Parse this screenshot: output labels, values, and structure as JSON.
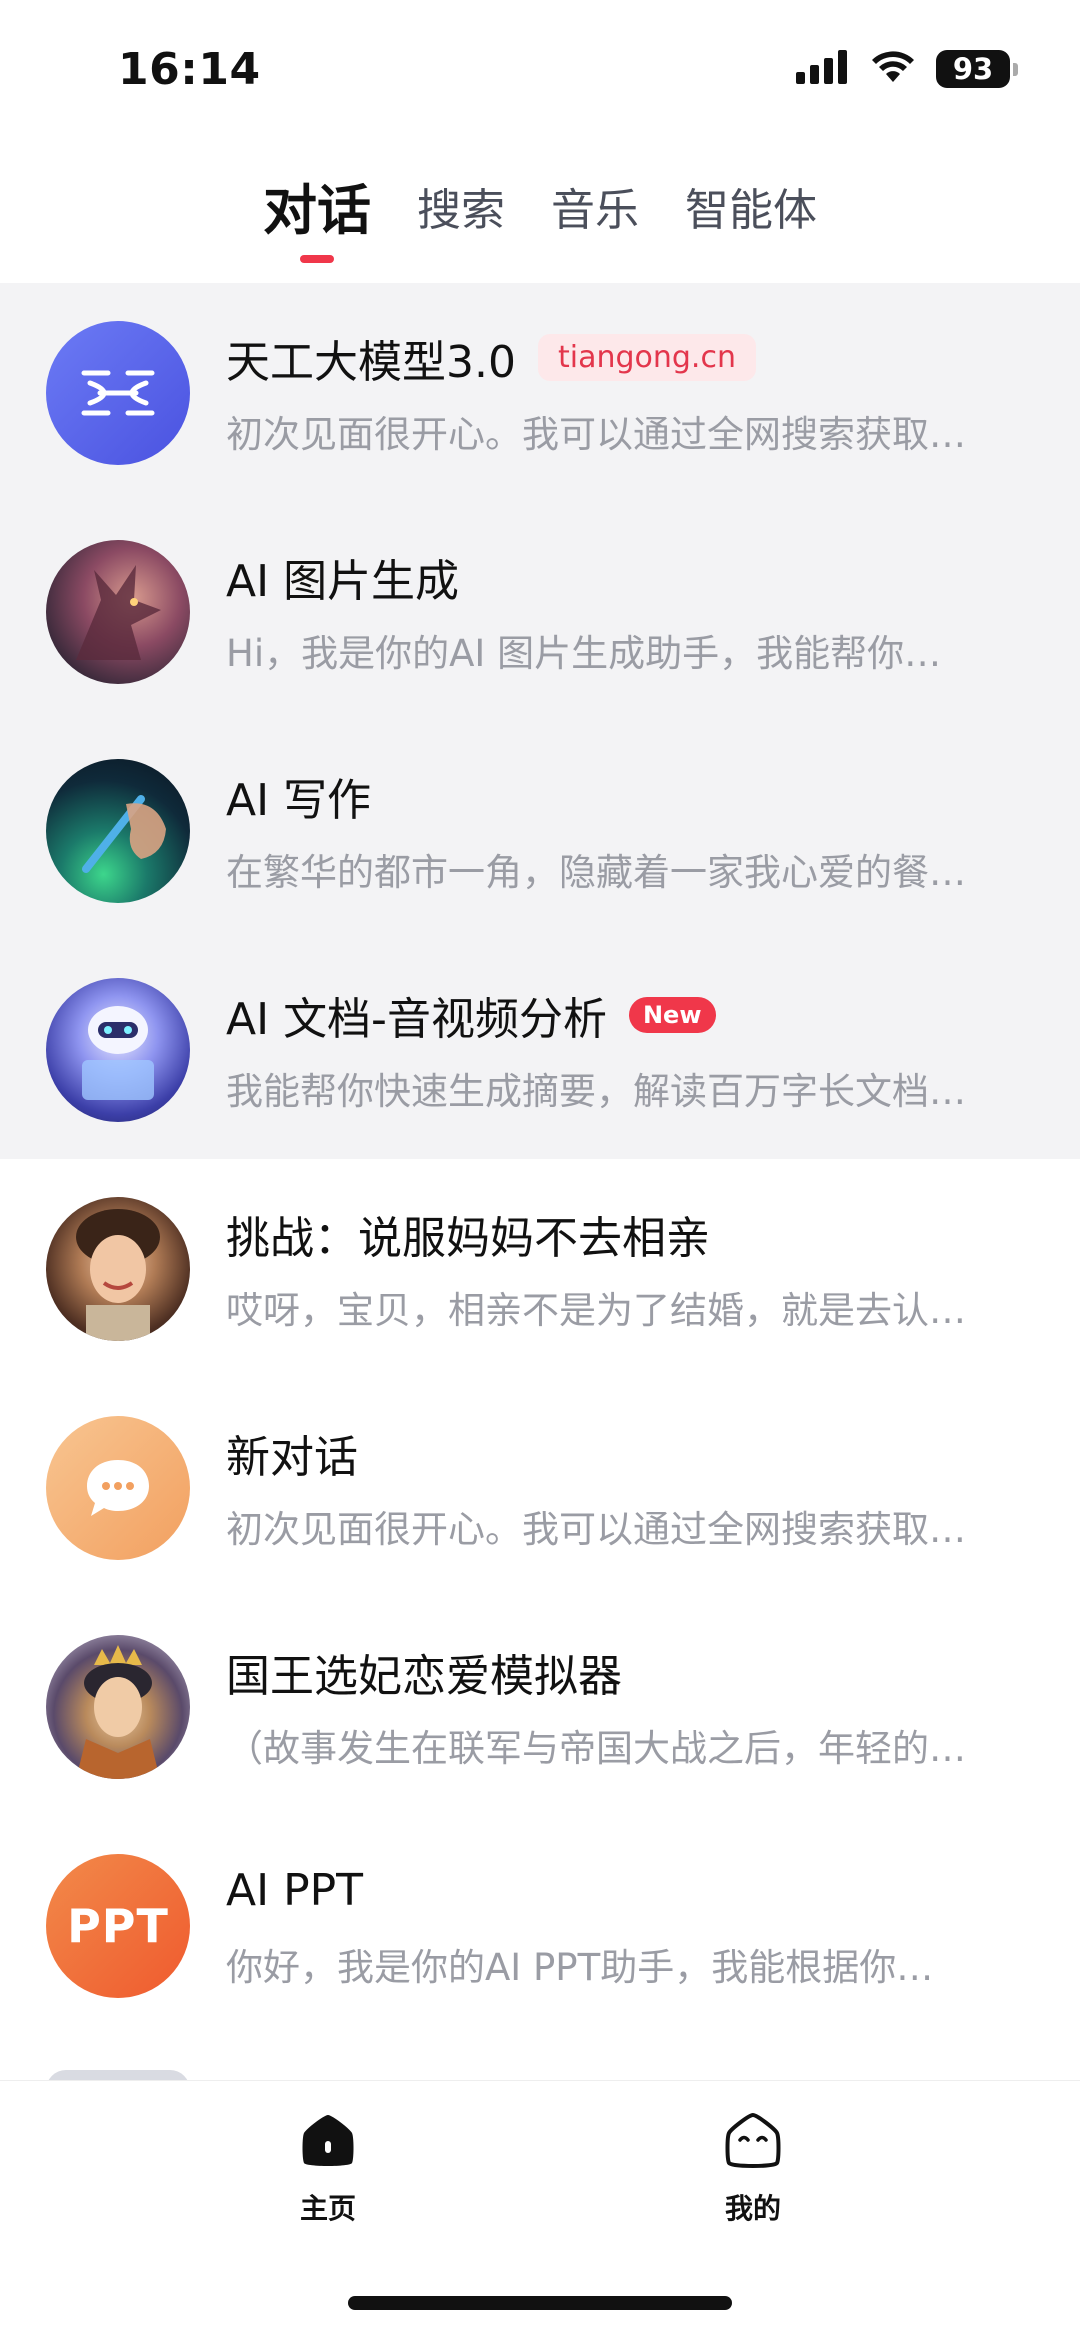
{
  "status_bar": {
    "time": "16:14",
    "battery": "93"
  },
  "top_tabs": [
    {
      "label": "对话",
      "active": true
    },
    {
      "label": "搜索",
      "active": false
    },
    {
      "label": "音乐",
      "active": false
    },
    {
      "label": "智能体",
      "active": false
    }
  ],
  "conversations": [
    {
      "title": "天工大模型3.0",
      "tag": "tiangong.cn",
      "subtitle": "初次见面很开心。我可以通过全网搜索获取…",
      "pinned": true,
      "avatar": "tiangong-logo"
    },
    {
      "title": "AI 图片生成",
      "subtitle": "Hi，我是你的AI 图片生成助手，我能帮你…",
      "pinned": true,
      "avatar": "dragon-image"
    },
    {
      "title": "AI 写作",
      "subtitle": "在繁华的都市一角，隐藏着一家我心爱的餐…",
      "pinned": true,
      "avatar": "writing-hand-image"
    },
    {
      "title": "AI 文档-音视频分析",
      "badge": "New",
      "subtitle": "我能帮你快速生成摘要，解读百万字长文档…",
      "pinned": true,
      "avatar": "robot-image"
    },
    {
      "title": "挑战：说服妈妈不去相亲",
      "subtitle": "哎呀，宝贝，相亲不是为了结婚，就是去认…",
      "pinned": false,
      "avatar": "mother-portrait"
    },
    {
      "title": "新对话",
      "subtitle": "初次见面很开心。我可以通过全网搜索获取…",
      "pinned": false,
      "avatar": "chat-bubble-icon"
    },
    {
      "title": "国王选妃恋爱模拟器",
      "subtitle": "（故事发生在联军与帝国大战之后，年轻的…",
      "pinned": false,
      "avatar": "king-portrait"
    },
    {
      "title": "AI PPT",
      "subtitle": "你好，我是你的AI PPT助手，我能根据你…",
      "pinned": false,
      "avatar": "ppt-logo",
      "avatar_text": "PPT"
    }
  ],
  "bottom_nav": {
    "home_label": "主页",
    "me_label": "我的"
  },
  "colors": {
    "accent": "#f0374a",
    "pinned_bg": "#f3f3f5",
    "subtitle": "#9a9ca4"
  }
}
